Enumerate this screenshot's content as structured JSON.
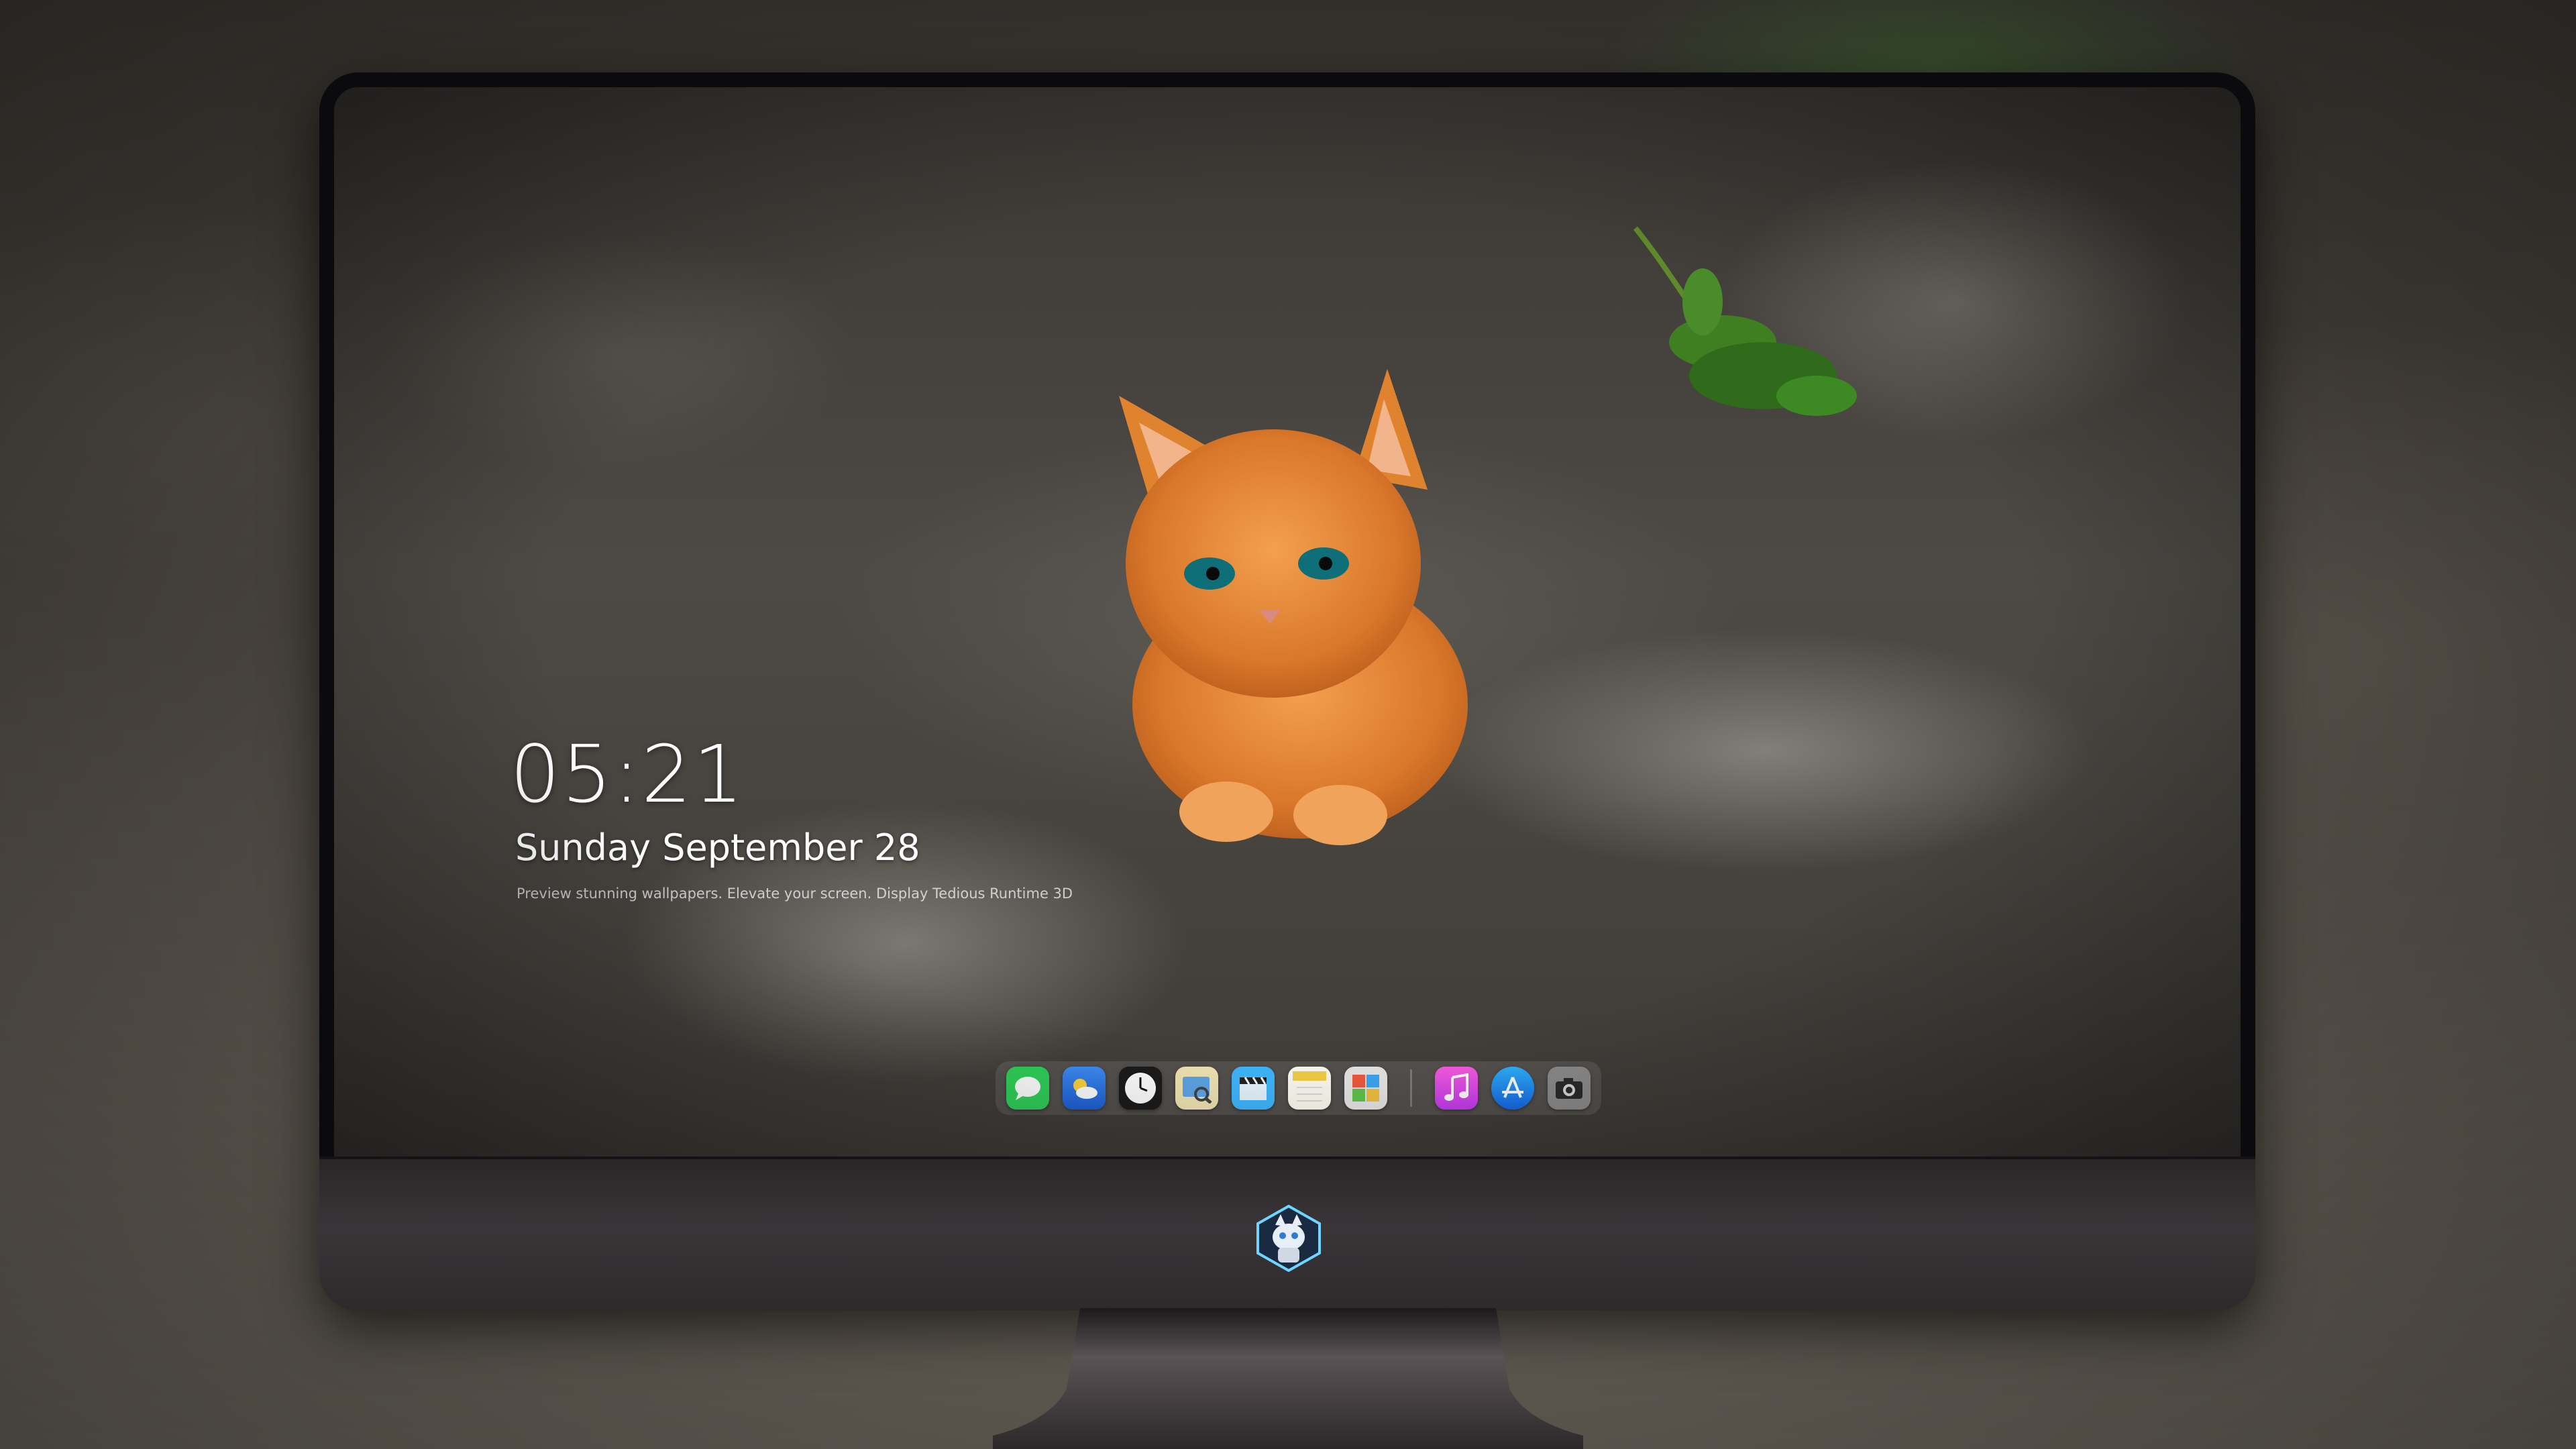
{
  "lockscreen": {
    "time": "05:21",
    "date": "Sunday September  28",
    "tagline": "Preview stunning wallpapers. Elevate your screen. Display Tedious Runtime 3D"
  },
  "dock": {
    "apps": [
      {
        "icon": "messages-icon",
        "color": "#2fd158"
      },
      {
        "icon": "weather-icon",
        "color": "#2a7df0"
      },
      {
        "icon": "clock-icon",
        "color": "#1b1b1b"
      },
      {
        "icon": "preview-icon",
        "color": "#e9d36a"
      },
      {
        "icon": "claquette-icon",
        "color": "#3fb8ff"
      },
      {
        "icon": "notes-icon",
        "color": "#f7d046"
      },
      {
        "icon": "photo-booth-icon",
        "color": "#e8e8e8"
      },
      {
        "icon": "music-icon",
        "color": "#f24ad4"
      },
      {
        "icon": "app-store-icon",
        "color": "#1e8ff5"
      },
      {
        "icon": "camera-icon",
        "color": "#8d8d8d"
      }
    ]
  },
  "brand": {
    "logo": "cat-astronaut-logo-icon"
  }
}
